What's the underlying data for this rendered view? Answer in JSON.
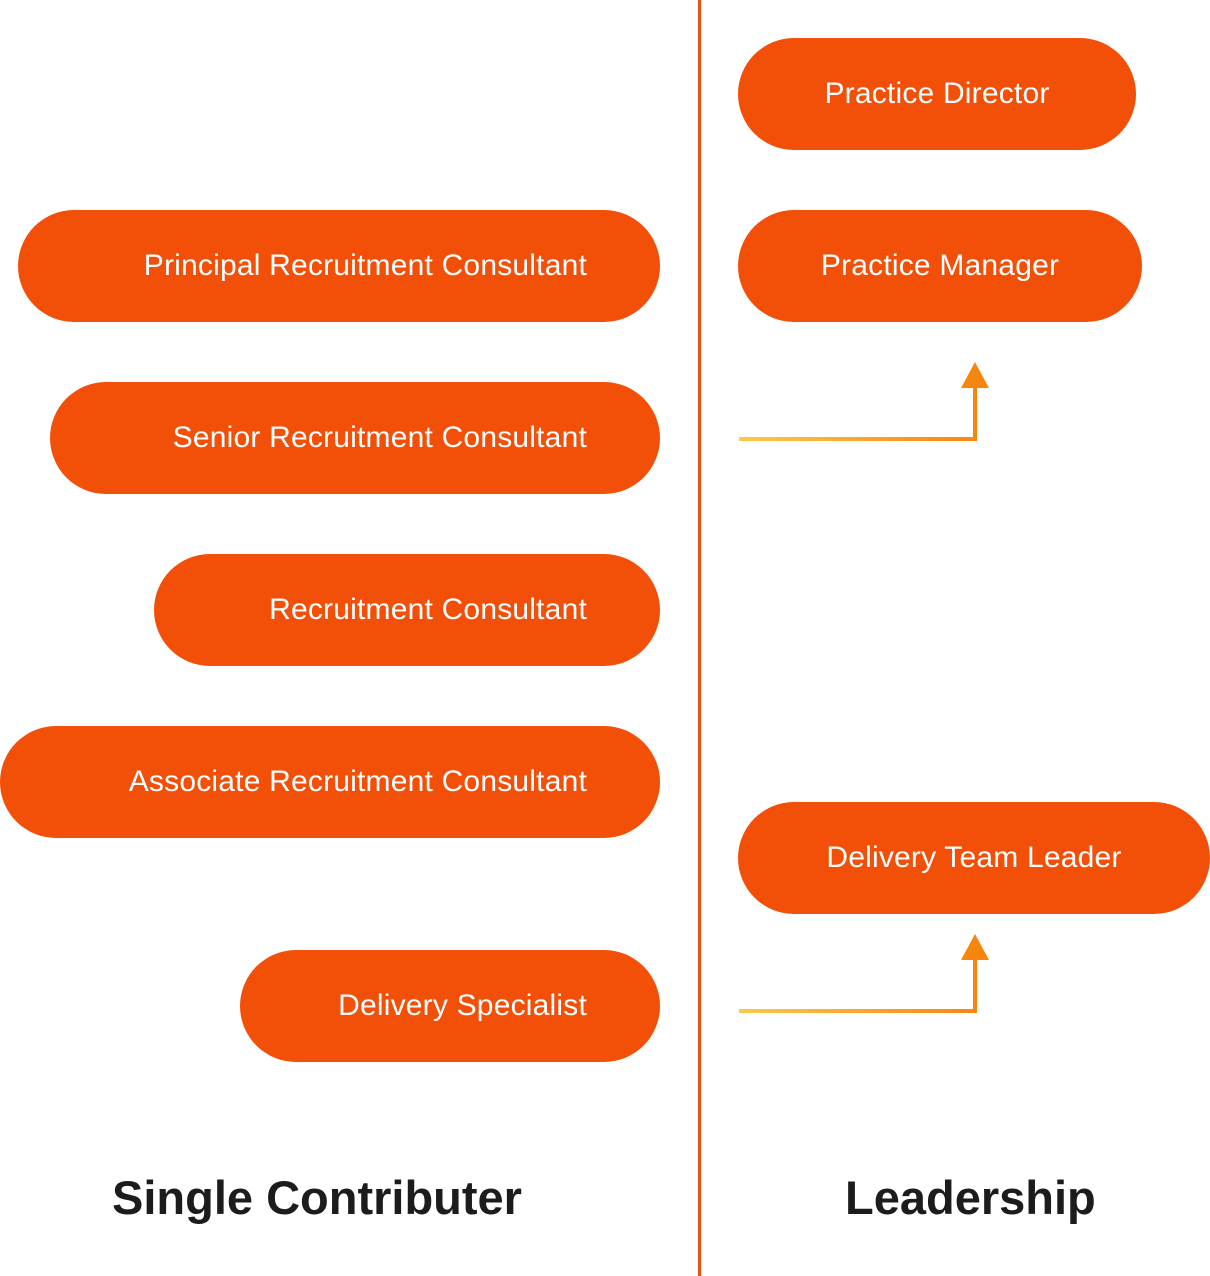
{
  "columns": {
    "single_contributor": {
      "title": "Single Contributer",
      "roles": [
        "Principal Recruitment Consultant",
        "Senior Recruitment Consultant",
        "Recruitment Consultant",
        "Associate Recruitment Consultant",
        "Delivery Specialist"
      ]
    },
    "leadership": {
      "title": "Leadership",
      "roles": [
        "Practice Director",
        "Practice Manager",
        "Delivery Team Leader"
      ]
    }
  },
  "transitions": [
    {
      "from": "Senior Recruitment Consultant",
      "to": "Practice Manager"
    },
    {
      "from": "Delivery Specialist",
      "to": "Delivery Team Leader"
    }
  ],
  "colors": {
    "pill": "#f24f08",
    "divider": "#e8540e",
    "arrow_start": "#fbc94a",
    "arrow_end": "#f7860f",
    "title_text": "#1c1c1c"
  }
}
